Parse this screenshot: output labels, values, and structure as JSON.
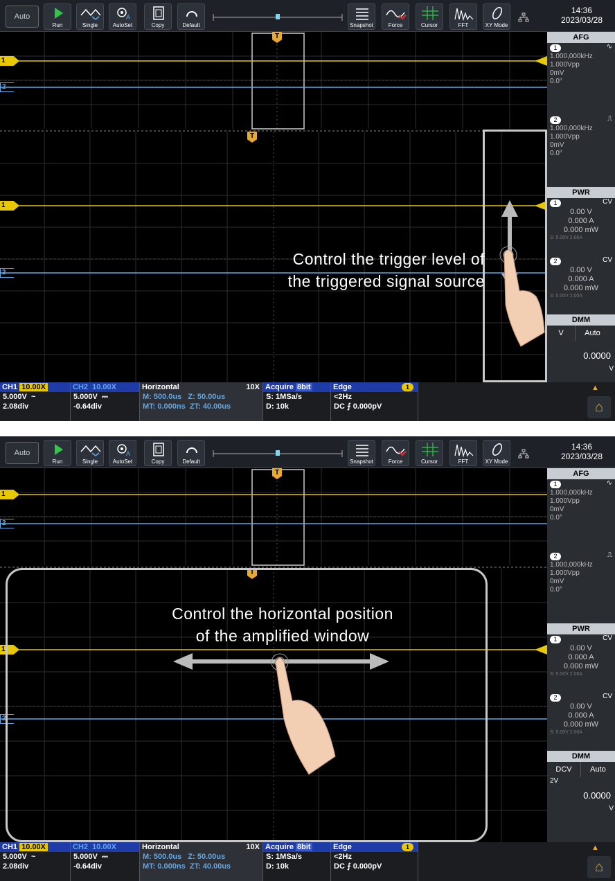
{
  "toolbar": {
    "mode": "Auto",
    "buttons": [
      {
        "label": "Run",
        "icon": "play-icon"
      },
      {
        "label": "Single",
        "icon": "single-wave-icon"
      },
      {
        "label": "AutoSet",
        "icon": "autoset-gear-icon"
      },
      {
        "label": "Copy",
        "icon": "copy-icon"
      },
      {
        "label": "Default",
        "icon": "default-reset-icon"
      },
      {
        "label": "Snapshot",
        "icon": "snapshot-list-icon"
      },
      {
        "label": "Force",
        "icon": "force-wave-icon"
      },
      {
        "label": "Cursor",
        "icon": "cursor-grid-icon"
      },
      {
        "label": "FFT",
        "icon": "fft-spectrum-icon"
      },
      {
        "label": "XY Mode",
        "icon": "xy-mode-icon"
      }
    ],
    "time": "14:36",
    "date": "2023/03/28"
  },
  "sidebar": {
    "afg": {
      "title": "AFG",
      "ch1": {
        "num": "1",
        "freq": "1.000,000kHz",
        "amp": "1.000Vpp",
        "offset": "0mV",
        "phase": "0.0°"
      },
      "ch2": {
        "num": "2",
        "freq": "1.000,000kHz",
        "amp": "1.000Vpp",
        "offset": "0mV",
        "phase": "0.0°"
      }
    },
    "pwr": {
      "title": "PWR",
      "ch1": {
        "num": "1",
        "mode": "CV",
        "v": "0.00 V",
        "a": "0.000 A",
        "w": "0.000 mW",
        "set": "S: 5.00V 2.00A"
      },
      "ch2": {
        "num": "2",
        "mode": "CV",
        "v": "0.00 V",
        "a": "0.000 A",
        "w": "0.000 mW",
        "set": "S: 5.00V 2.00A"
      }
    },
    "dmm": {
      "title": "DMM",
      "mode_a": "V",
      "mode": "DCV",
      "range": "Auto",
      "range_value": "2V",
      "value": "0.0000",
      "unit": "V"
    }
  },
  "bottom": {
    "ch1": {
      "label": "CH1",
      "probe": "10.00X",
      "volts": "5.000V",
      "coupling": "~",
      "pos": "2.08div"
    },
    "ch2": {
      "label": "CH2",
      "probe": "10.00X",
      "volts": "5.000V",
      "coupling": "⎓",
      "pos": "-0.64div"
    },
    "horizontal": {
      "label": "Horizontal",
      "zoom": "10X",
      "m": "M: 500.0us",
      "z": "Z: 50.00us",
      "mt": "MT: 0.000ns",
      "zt": "ZT: 40.00us"
    },
    "acquire": {
      "label": "Acquire",
      "bits": "8bit",
      "s": "S: 1MSa/s",
      "d": "D: 10k"
    },
    "trigger": {
      "label": "Edge",
      "src": "1",
      "freq": "<2Hz",
      "level": "DC ⨍ 0.000pV"
    }
  },
  "markers": {
    "ch1": "1",
    "ch2": "2",
    "trigger": "T"
  },
  "captions": {
    "top_1": "Control the trigger level of",
    "top_2": "the triggered signal source",
    "bottom_1": "Control the horizontal position",
    "bottom_2": "of the amplified window"
  },
  "colors": {
    "ch1": "#e8c800",
    "ch2": "#5fa8e8",
    "trigger": "#e8a930",
    "background": "#000000"
  }
}
